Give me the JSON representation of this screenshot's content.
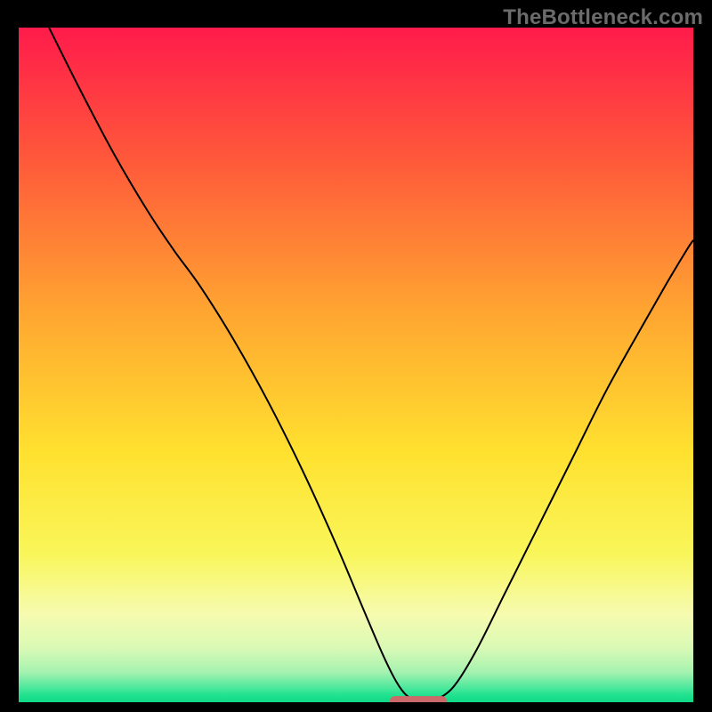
{
  "watermark": "TheBottleneck.com",
  "chart_data": {
    "type": "line",
    "title": "",
    "xlabel": "",
    "ylabel": "",
    "xlim": [
      0,
      100
    ],
    "ylim": [
      0,
      100
    ],
    "background_gradient": {
      "stops": [
        {
          "at": 0.0,
          "color": "#ff1b4b"
        },
        {
          "at": 0.2,
          "color": "#ff5a3a"
        },
        {
          "at": 0.42,
          "color": "#ffa531"
        },
        {
          "at": 0.63,
          "color": "#ffe12f"
        },
        {
          "at": 0.78,
          "color": "#f9f65a"
        },
        {
          "at": 0.87,
          "color": "#f6fbb0"
        },
        {
          "at": 0.92,
          "color": "#d9f9b5"
        },
        {
          "at": 0.955,
          "color": "#a6f2b0"
        },
        {
          "at": 0.975,
          "color": "#5be9a0"
        },
        {
          "at": 0.99,
          "color": "#1fe28f"
        },
        {
          "at": 1.0,
          "color": "#10d985"
        }
      ]
    },
    "series": [
      {
        "name": "curve",
        "color": "#000000",
        "width": 2,
        "points": [
          {
            "x": 4.5,
            "y": 100.0
          },
          {
            "x": 9.0,
            "y": 91.0
          },
          {
            "x": 14.0,
            "y": 81.5
          },
          {
            "x": 19.0,
            "y": 73.0
          },
          {
            "x": 23.0,
            "y": 67.0
          },
          {
            "x": 27.0,
            "y": 61.5
          },
          {
            "x": 32.0,
            "y": 53.5
          },
          {
            "x": 37.0,
            "y": 44.5
          },
          {
            "x": 42.0,
            "y": 34.5
          },
          {
            "x": 47.0,
            "y": 23.5
          },
          {
            "x": 51.0,
            "y": 14.0
          },
          {
            "x": 54.0,
            "y": 7.0
          },
          {
            "x": 56.0,
            "y": 3.0
          },
          {
            "x": 57.5,
            "y": 1.0
          },
          {
            "x": 59.0,
            "y": 0.3
          },
          {
            "x": 61.0,
            "y": 0.3
          },
          {
            "x": 63.0,
            "y": 1.0
          },
          {
            "x": 65.0,
            "y": 3.0
          },
          {
            "x": 68.0,
            "y": 8.0
          },
          {
            "x": 72.0,
            "y": 16.0
          },
          {
            "x": 77.0,
            "y": 26.0
          },
          {
            "x": 82.0,
            "y": 36.0
          },
          {
            "x": 87.0,
            "y": 46.0
          },
          {
            "x": 92.0,
            "y": 55.0
          },
          {
            "x": 96.0,
            "y": 62.0
          },
          {
            "x": 99.0,
            "y": 67.0
          },
          {
            "x": 100.0,
            "y": 68.5
          }
        ]
      }
    ],
    "marker": {
      "color": "#cc6a6a",
      "x_start": 55.0,
      "x_end": 63.5,
      "y": 0.15,
      "thickness": 1.5,
      "rounded": true
    }
  }
}
